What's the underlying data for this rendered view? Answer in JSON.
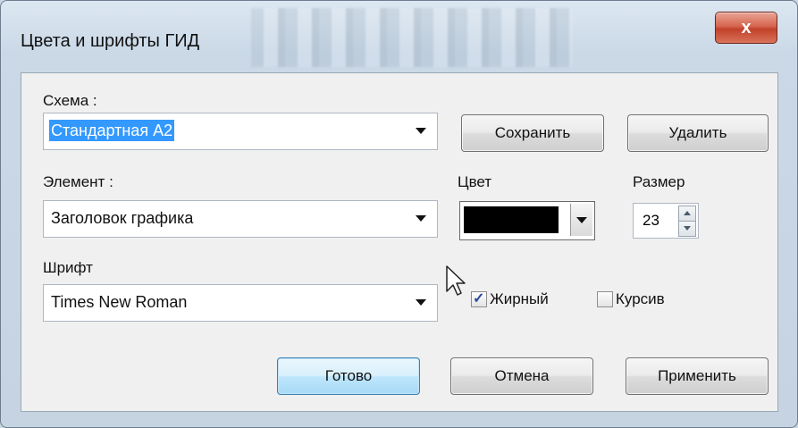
{
  "window": {
    "title": "Цвета и шрифты ГИД",
    "close_label": "x"
  },
  "scheme": {
    "label": "Схема :",
    "value": "Стандартная А2",
    "save_label": "Сохранить",
    "delete_label": "Удалить"
  },
  "element": {
    "label": "Элемент :",
    "value": "Заголовок графика"
  },
  "color": {
    "label": "Цвет",
    "value_hex": "#000000"
  },
  "size": {
    "label": "Размер",
    "value": "23"
  },
  "font": {
    "label": "Шрифт",
    "value": "Times New Roman"
  },
  "bold": {
    "label": "Жирный",
    "checked": true
  },
  "italic": {
    "label": "Курсив",
    "checked": false
  },
  "buttons": {
    "ok": "Готово",
    "cancel": "Отмена",
    "apply": "Применить"
  }
}
